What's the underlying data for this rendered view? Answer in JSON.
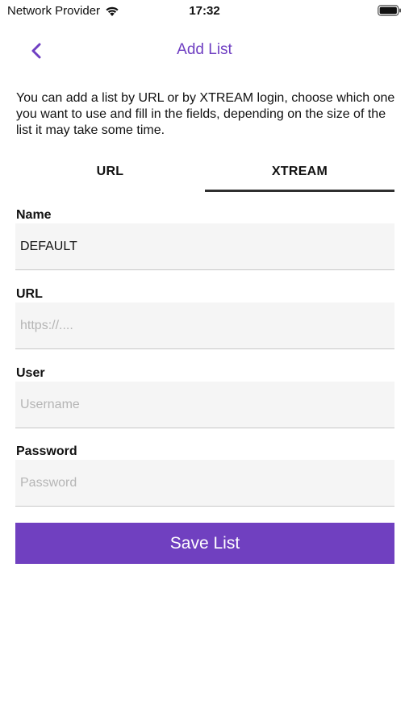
{
  "status_bar": {
    "carrier": "Network Provider",
    "time": "17:32",
    "wifi_icon": "wifi-icon",
    "battery_icon": "battery-icon"
  },
  "nav": {
    "title": "Add List",
    "back_icon": "chevron-left-icon"
  },
  "description": "You can add a list by URL or by XTREAM login, choose which one you want to use and fill in the fields, depending on the size of the list it may take some time.",
  "tabs": [
    {
      "label": "URL",
      "active": false
    },
    {
      "label": "XTREAM",
      "active": true
    }
  ],
  "form": {
    "name": {
      "label": "Name",
      "value": "DEFAULT",
      "placeholder": ""
    },
    "url": {
      "label": "URL",
      "value": "",
      "placeholder": "https://...."
    },
    "user": {
      "label": "User",
      "value": "",
      "placeholder": "Username"
    },
    "password": {
      "label": "Password",
      "value": "",
      "placeholder": "Password"
    }
  },
  "save_button": {
    "label": "Save List"
  },
  "colors": {
    "accent": "#7040c0",
    "title": "#6f3fc2",
    "field_bg": "#f5f5f5"
  }
}
